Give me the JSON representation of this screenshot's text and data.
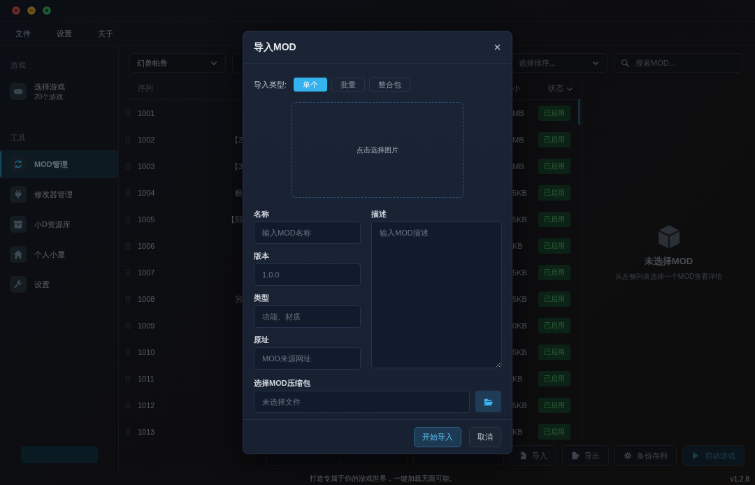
{
  "window": {
    "controls": [
      {
        "kind": "close",
        "color": "#6a2b29"
      },
      {
        "kind": "minimize",
        "color": "#6a5419"
      },
      {
        "kind": "maximize",
        "color": "#1f5a36"
      }
    ]
  },
  "menu": [
    "文件",
    "设置",
    "关于"
  ],
  "sidebar": {
    "sections": [
      {
        "title": "游戏",
        "items": [
          {
            "label": "选择游戏",
            "sub": "20个游戏",
            "selected": false
          }
        ]
      },
      {
        "title": "工具",
        "items": [
          {
            "label": "MOD管理",
            "selected": true
          },
          {
            "label": "修改器管理",
            "selected": false
          },
          {
            "label": "小D资源库",
            "selected": false
          },
          {
            "label": "个人小屋",
            "selected": false
          },
          {
            "label": "设置",
            "selected": false
          }
        ]
      }
    ]
  },
  "toolbar": {
    "game_select": {
      "value": "幻兽帕鲁"
    },
    "sort_select": {
      "placeholder": "选择排序..."
    },
    "search": {
      "placeholder": "搜索MOD..."
    }
  },
  "table": {
    "columns": [
      "序列",
      "小",
      "状态"
    ],
    "rows": [
      {
        "id": "1001",
        "column_3": "MB",
        "status": "已启用"
      },
      {
        "id": "1002",
        "column_2": "【2",
        "column_3": "MB",
        "status": "已启用"
      },
      {
        "id": "1003",
        "column_2": "【3",
        "column_3": "MB",
        "status": "已启用"
      },
      {
        "id": "1004",
        "column_2": "极",
        "column_3": "5KB",
        "status": "已启用"
      },
      {
        "id": "1005",
        "column_2": "【部",
        "column_3": "5KB",
        "status": "已启用"
      },
      {
        "id": "1006",
        "column_3": "KB",
        "status": "已启用"
      },
      {
        "id": "1007",
        "column_3": "5KB",
        "status": "已启用"
      },
      {
        "id": "1008",
        "column_2": "另",
        "column_3": "5KB",
        "status": "已启用"
      },
      {
        "id": "1009",
        "column_3": "0KB",
        "status": "已启用"
      },
      {
        "id": "1010",
        "column_3": "5KB",
        "status": "已启用"
      },
      {
        "id": "1011",
        "column_3": "KB",
        "status": "已启用"
      },
      {
        "id": "1012",
        "column_3": "5KB",
        "status": "已启用"
      },
      {
        "id": "1013",
        "column_3": "KB",
        "status": "已启用"
      }
    ]
  },
  "detail": {
    "title": "未选择MOD",
    "hint": "从左侧列表选择一个MOD查看详情"
  },
  "actions": [
    {
      "kind": "covered"
    },
    {
      "kind": "covered"
    },
    {
      "kind": "covered"
    },
    {
      "kind": "plain",
      "label": "导入"
    },
    {
      "kind": "plain",
      "label": "导出"
    },
    {
      "kind": "plain",
      "label": "备份存档"
    },
    {
      "kind": "launch",
      "label": "启动游戏"
    }
  ],
  "footer": {
    "tagline": "打造专属于你的游戏世界，一键加载无限可能。",
    "version": "v1.2.8"
  },
  "dialog": {
    "title": "导入MOD",
    "type_label": "导入类型:",
    "types": [
      {
        "label": "单个",
        "selected": true
      },
      {
        "label": "批量",
        "selected": false
      },
      {
        "label": "整合包",
        "selected": false
      }
    ],
    "dropzone": "点击选择图片",
    "fields": [
      {
        "label": "名称",
        "placeholder": "输入MOD名称"
      },
      {
        "label": "版本",
        "placeholder": "1.0.0"
      },
      {
        "label": "类型",
        "placeholder": "功能、材质"
      },
      {
        "label": "原址",
        "placeholder": "MOD来源网址"
      }
    ],
    "description": {
      "label": "描述",
      "placeholder": "输入MOD描述"
    },
    "file": {
      "label": "选择MOD压缩包",
      "placeholder": "未选择文件"
    },
    "buttons": [
      {
        "label": "开始导入",
        "kind": "primary"
      },
      {
        "label": "取消",
        "kind": "secondary"
      }
    ]
  }
}
